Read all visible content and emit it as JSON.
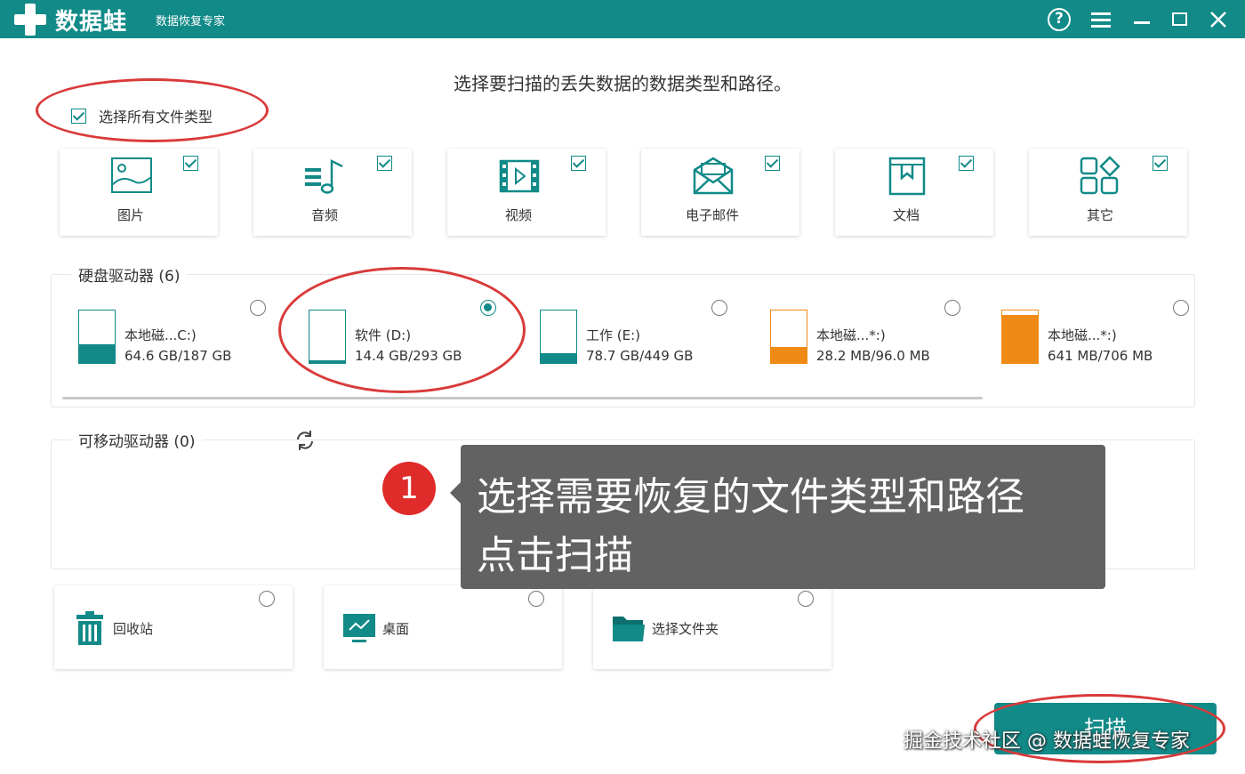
{
  "titlebar": {
    "app_name": "数据蛙",
    "app_subtitle": "数据恢复专家",
    "colors": {
      "brand": "#118a88",
      "accent_orange": "#f08a16",
      "annotation_red": "#d93a3a"
    }
  },
  "header": {
    "title": "选择要扫描的丢失数据的数据类型和路径。"
  },
  "select_all": {
    "label": "选择所有文件类型",
    "checked": true
  },
  "file_types": [
    {
      "label": "图片",
      "icon": "image-icon",
      "checked": true
    },
    {
      "label": "音频",
      "icon": "music-icon",
      "checked": true
    },
    {
      "label": "视频",
      "icon": "video-icon",
      "checked": true
    },
    {
      "label": "电子邮件",
      "icon": "mail-icon",
      "checked": true
    },
    {
      "label": "文档",
      "icon": "document-icon",
      "checked": true
    },
    {
      "label": "其它",
      "icon": "other-icon",
      "checked": true
    }
  ],
  "hard_drives": {
    "title": "硬盘驱动器 (6)",
    "items": [
      {
        "name": "本地磁...C:)",
        "size": "64.6 GB/187 GB",
        "color": "#118a88",
        "fill": 0.35,
        "selected": false
      },
      {
        "name": "软件 (D:)",
        "size": "14.4 GB/293 GB",
        "color": "#118a88",
        "fill": 0.05,
        "selected": true
      },
      {
        "name": "工作 (E:)",
        "size": "78.7 GB/449 GB",
        "color": "#118a88",
        "fill": 0.18,
        "selected": false
      },
      {
        "name": "本地磁...*:)",
        "size": "28.2 MB/96.0 MB",
        "color": "#f08a16",
        "fill": 0.3,
        "selected": false
      },
      {
        "name": "本地磁...*:)",
        "size": "641 MB/706 MB",
        "color": "#f08a16",
        "fill": 0.91,
        "selected": false
      }
    ]
  },
  "removable": {
    "title": "可移动驱动器 (0)"
  },
  "locations": [
    {
      "label": "回收站",
      "icon": "trash-icon"
    },
    {
      "label": "桌面",
      "icon": "monitor-icon"
    },
    {
      "label": "选择文件夹",
      "icon": "folder-icon"
    }
  ],
  "tooltip": {
    "badge": "1",
    "line1": "选择需要恢复的文件类型和路径",
    "line2": "点击扫描"
  },
  "scan_button": {
    "label": "扫描"
  },
  "watermark": {
    "text": "掘金技术社区 @ 数据蛙恢复专家"
  }
}
